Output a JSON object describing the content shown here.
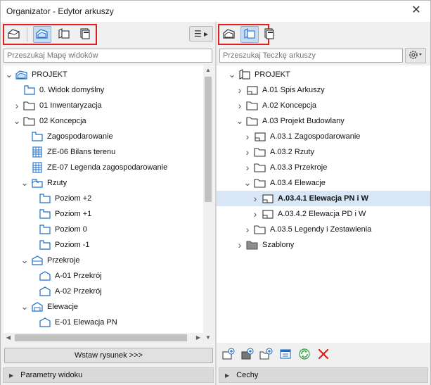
{
  "window": {
    "title": "Organizator - Edytor arkuszy",
    "close_glyph": "✕"
  },
  "left_pane": {
    "search_placeholder": "Przeszukaj Mapę widoków",
    "menu_glyph": "☰ ▸",
    "insert_button_label": "Wstaw rysunek >>>",
    "bottom_panel_label": "Parametry widoku",
    "toolbar_buttons": [
      {
        "icon": "project-map-icon",
        "active": false
      },
      {
        "icon": "view-map-icon",
        "active": true
      },
      {
        "icon": "layout-book-icon",
        "active": false
      },
      {
        "icon": "publisher-sets-icon",
        "active": false
      }
    ],
    "tree": [
      {
        "label": "PROJEKT",
        "depth": 0,
        "chev": "v",
        "icon": "project-icon"
      },
      {
        "label": "0. Widok domyślny",
        "depth": 1,
        "chev": "",
        "icon": "view-folder-icon"
      },
      {
        "label": "01 Inwentaryzacja",
        "depth": 1,
        "chev": ">",
        "icon": "folder-icon"
      },
      {
        "label": "02 Koncepcja",
        "depth": 1,
        "chev": "v",
        "icon": "folder-icon"
      },
      {
        "label": "Zagospodarowanie",
        "depth": 2,
        "chev": "",
        "icon": "view-folder-icon"
      },
      {
        "label": "ZE-06 Bilans terenu",
        "depth": 2,
        "chev": "",
        "icon": "schedule-icon"
      },
      {
        "label": "ZE-07 Legenda zagospodarowanie",
        "depth": 2,
        "chev": "",
        "icon": "schedule-icon"
      },
      {
        "label": "Rzuty",
        "depth": 2,
        "chev": "v",
        "icon": "floorplan-folder-icon"
      },
      {
        "label": "Poziom +2",
        "depth": 3,
        "chev": "",
        "icon": "floorplan-icon"
      },
      {
        "label": "Poziom +1",
        "depth": 3,
        "chev": "",
        "icon": "floorplan-icon"
      },
      {
        "label": "Poziom 0",
        "depth": 3,
        "chev": "",
        "icon": "floorplan-icon"
      },
      {
        "label": "Poziom -1",
        "depth": 3,
        "chev": "",
        "icon": "floorplan-icon"
      },
      {
        "label": "Przekroje",
        "depth": 2,
        "chev": "v",
        "icon": "section-folder-icon"
      },
      {
        "label": "A-01 Przekrój",
        "depth": 3,
        "chev": "",
        "icon": "section-icon"
      },
      {
        "label": "A-02 Przekrój",
        "depth": 3,
        "chev": "",
        "icon": "section-icon"
      },
      {
        "label": "Elewacje",
        "depth": 2,
        "chev": "v",
        "icon": "elevation-folder-icon"
      },
      {
        "label": "E-01 Elewacja PN",
        "depth": 3,
        "chev": "",
        "icon": "elevation-icon"
      }
    ]
  },
  "right_pane": {
    "search_placeholder": "Przeszukaj Teczkę arkuszy",
    "bottom_panel_label": "Cechy",
    "toolbar_buttons": [
      {
        "icon": "view-map-icon",
        "active": false
      },
      {
        "icon": "layout-book-icon",
        "active": true
      },
      {
        "icon": "publisher-sets-icon",
        "active": false
      }
    ],
    "tree": [
      {
        "label": "PROJEKT",
        "depth": 0,
        "chev": "v",
        "icon": "layout-book-icon",
        "selected": false,
        "bold": false
      },
      {
        "label": "A.01 Spis Arkuszy",
        "depth": 1,
        "chev": ">",
        "icon": "layout-icon",
        "selected": false,
        "bold": false
      },
      {
        "label": "A.02 Koncepcja",
        "depth": 1,
        "chev": ">",
        "icon": "subset-folder-icon",
        "selected": false,
        "bold": false
      },
      {
        "label": "A.03 Projekt Budowlany",
        "depth": 1,
        "chev": "v",
        "icon": "subset-folder-icon",
        "selected": false,
        "bold": false
      },
      {
        "label": "A.03.1 Zagospodarowanie",
        "depth": 2,
        "chev": ">",
        "icon": "layout-icon",
        "selected": false,
        "bold": false
      },
      {
        "label": "A.03.2 Rzuty",
        "depth": 2,
        "chev": ">",
        "icon": "subset-folder-icon",
        "selected": false,
        "bold": false
      },
      {
        "label": "A.03.3 Przekroje",
        "depth": 2,
        "chev": ">",
        "icon": "subset-folder-icon",
        "selected": false,
        "bold": false
      },
      {
        "label": "A.03.4 Elewacje",
        "depth": 2,
        "chev": "v",
        "icon": "subset-folder-icon",
        "selected": false,
        "bold": false
      },
      {
        "label": "A.03.4.1 Elewacja PN i W",
        "depth": 3,
        "chev": ">",
        "icon": "layout-icon",
        "selected": true,
        "bold": true
      },
      {
        "label": "A.03.4.2 Elewacja PD i W",
        "depth": 3,
        "chev": ">",
        "icon": "layout-icon",
        "selected": false,
        "bold": false
      },
      {
        "label": "A.03.5 Legendy i Zestawienia",
        "depth": 2,
        "chev": ">",
        "icon": "subset-folder-icon",
        "selected": false,
        "bold": false
      },
      {
        "label": "Szablony",
        "depth": 1,
        "chev": ">",
        "icon": "master-folder-icon",
        "selected": false,
        "bold": false
      }
    ],
    "action_buttons": [
      {
        "icon": "new-layout-icon",
        "color": "#1e6fc9"
      },
      {
        "icon": "new-master-icon",
        "color": "#1e6fc9"
      },
      {
        "icon": "new-subset-icon",
        "color": "#1e6fc9"
      },
      {
        "icon": "settings-list-icon",
        "color": "#1e6fc9"
      },
      {
        "icon": "update-icon",
        "color": "#2a9d3a"
      },
      {
        "icon": "delete-icon",
        "color": "#e0201a"
      }
    ]
  },
  "colors": {
    "highlight_box": "#e02020",
    "active_button_bg": "#c9dcef",
    "selected_row_bg": "#d8e6f5",
    "icon_blue": "#1e6fc9"
  }
}
